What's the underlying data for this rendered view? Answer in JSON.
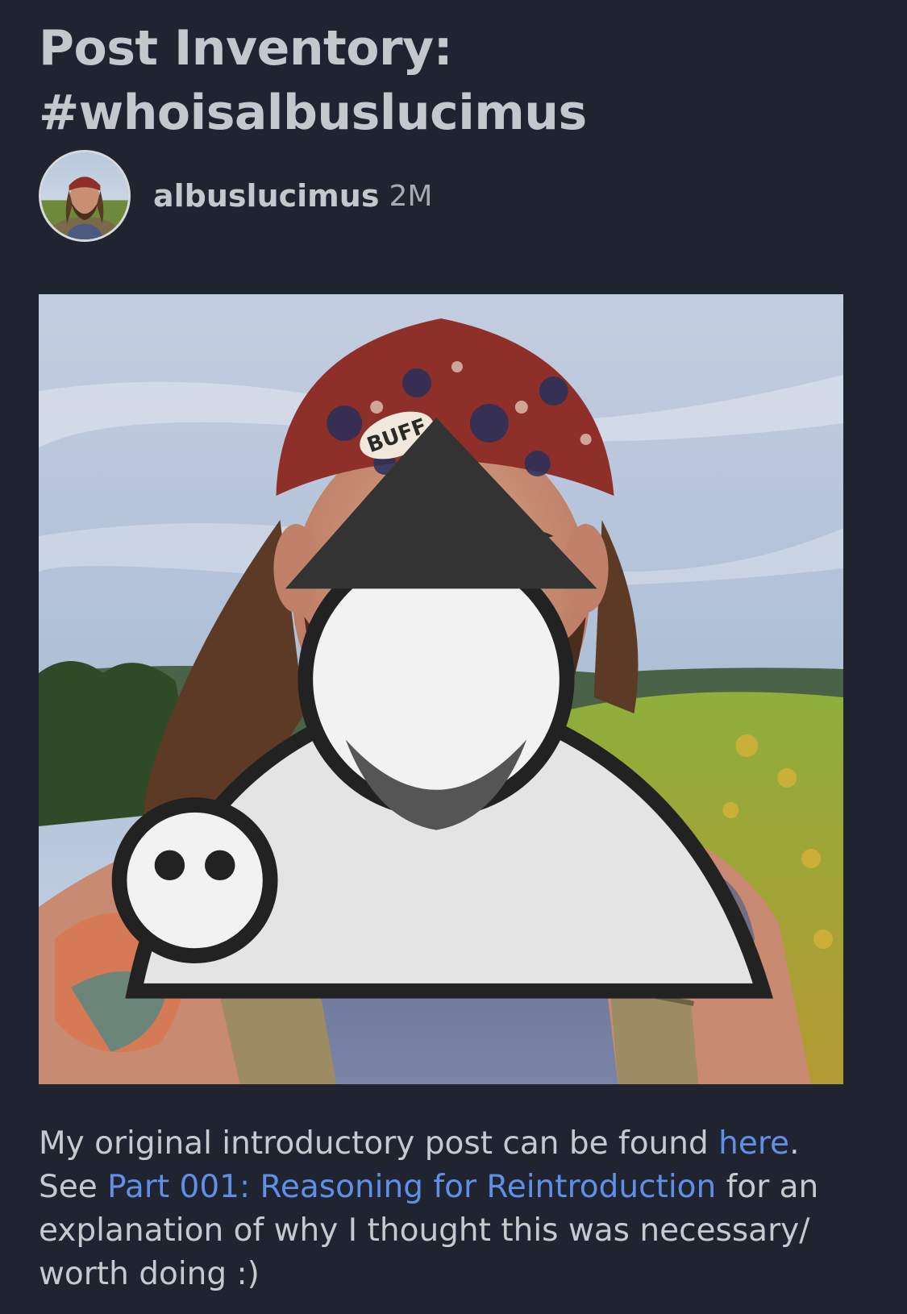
{
  "post": {
    "title": "Post Inventory: #whoisalbuslucimus",
    "author": {
      "name": "albuslucimus",
      "age": "2M"
    },
    "body": {
      "line1_prefix": "My original introductory post can be found ",
      "line1_link": "here",
      "line1_suffix": ".",
      "line2_prefix": "See ",
      "line2_link": "Part 001: Reasoning for Reintroduction",
      "line2_suffix": " for an explanation of why I thought this was necessary/ worth doing :)"
    },
    "image": {
      "headband_text": "BUFF"
    }
  },
  "colors": {
    "background": "#1f2430",
    "text": "#c6c9ce",
    "link": "#5f8fe6"
  }
}
